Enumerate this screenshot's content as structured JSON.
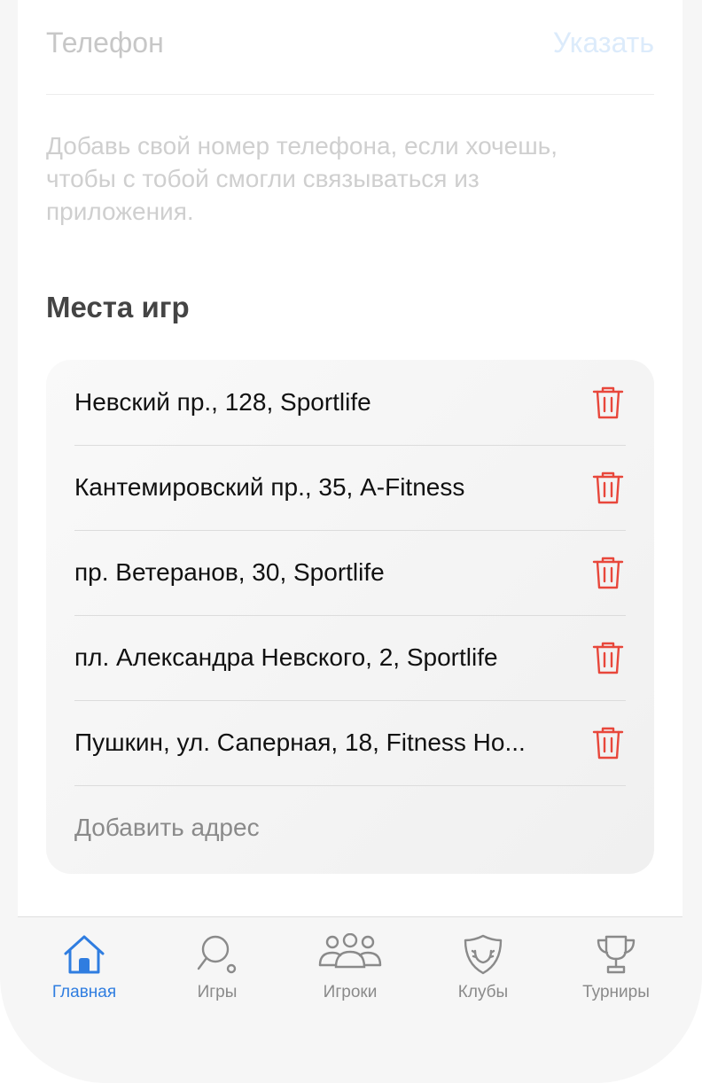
{
  "phone_row": {
    "label": "Телефон",
    "action": "Указать"
  },
  "hint": "Добавь свой номер телефона, если хочешь, чтобы с тобой смогли связываться из приложения.",
  "places_section": {
    "title": "Места игр",
    "items": [
      {
        "label": "Невский пр., 128, Sportlife"
      },
      {
        "label": "Кантемировский пр., 35, A-Fitness"
      },
      {
        "label": "пр. Ветеранов, 30, Sportlife"
      },
      {
        "label": "пл. Александра Невского, 2, Sportlife"
      },
      {
        "label": "Пушкин, ул. Саперная, 18, Fitness Ho..."
      }
    ],
    "add_label": "Добавить адрес",
    "delete_icon": "trash-icon",
    "delete_color": "#e8473b"
  },
  "tabbar": {
    "active_color": "#2f7de0",
    "inactive_color": "#8a8a8a",
    "tabs": [
      {
        "label": "Главная",
        "icon": "home-icon",
        "active": true
      },
      {
        "label": "Игры",
        "icon": "ping-pong-paddle-icon",
        "active": false
      },
      {
        "label": "Игроки",
        "icon": "players-icon",
        "active": false
      },
      {
        "label": "Клубы",
        "icon": "shield-icon",
        "active": false
      },
      {
        "label": "Турниры",
        "icon": "trophy-icon",
        "active": false
      }
    ]
  }
}
